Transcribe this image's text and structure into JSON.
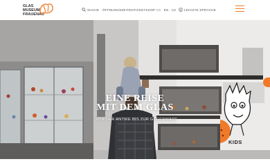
{
  "brand": {
    "logo_lines": [
      "GLAS",
      "MUSEUM",
      "FRAUENAU"
    ],
    "accent_color": "#f07a2a"
  },
  "nav": {
    "search": {
      "label": "SUCHE",
      "icon": "search-icon"
    },
    "opening_hours": {
      "label": "ÖFFNUNGSZEITEN"
    },
    "tickets": {
      "label": "TICKETSHOP"
    },
    "languages": [
      {
        "code": "DE",
        "active": false
      },
      {
        "code": "EN",
        "active": true
      },
      {
        "code": "CZ",
        "active": true
      }
    ],
    "easy_language": {
      "label": "LEICHTE SPRACHE",
      "icon": "easy-language-icon"
    },
    "menu_icon": "hamburger-menu-icon"
  },
  "hero": {
    "title_line1": "EINE REISE",
    "title_line2": "MIT DEM GLAS",
    "subtitle": "VON DER ANTIKE BIS ZUR GEGENWART",
    "kids_label": "KIDS"
  }
}
